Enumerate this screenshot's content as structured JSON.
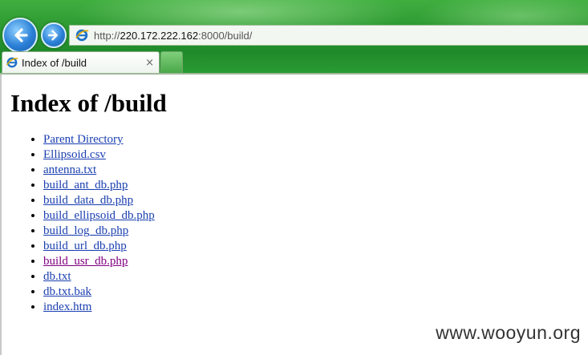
{
  "browser": {
    "address": {
      "prefix": "http://",
      "host": "220.172.222.162",
      "suffix": ":8000/build/"
    },
    "tab": {
      "title": "Index of /build",
      "close_glyph": "×"
    },
    "icons": {
      "back": "back-arrow-icon",
      "forward": "forward-arrow-icon",
      "page": "ie-page-icon"
    }
  },
  "page": {
    "title": "Index of /build",
    "items": [
      {
        "label": "Parent Directory",
        "visited": false
      },
      {
        "label": "Ellipsoid.csv",
        "visited": false
      },
      {
        "label": "antenna.txt",
        "visited": false
      },
      {
        "label": "build_ant_db.php",
        "visited": false
      },
      {
        "label": "build_data_db.php",
        "visited": false
      },
      {
        "label": "build_ellipsoid_db.php",
        "visited": false
      },
      {
        "label": "build_log_db.php",
        "visited": false
      },
      {
        "label": "build_url_db.php",
        "visited": false
      },
      {
        "label": "build_usr_db.php",
        "visited": true
      },
      {
        "label": "db.txt",
        "visited": false
      },
      {
        "label": "db.txt.bak",
        "visited": false
      },
      {
        "label": "index.htm",
        "visited": false
      }
    ]
  },
  "watermark": "www.wooyun.org",
  "colors": {
    "link": "#1a3fb0",
    "visited": "#800080",
    "chrome": "#2e9a32"
  }
}
